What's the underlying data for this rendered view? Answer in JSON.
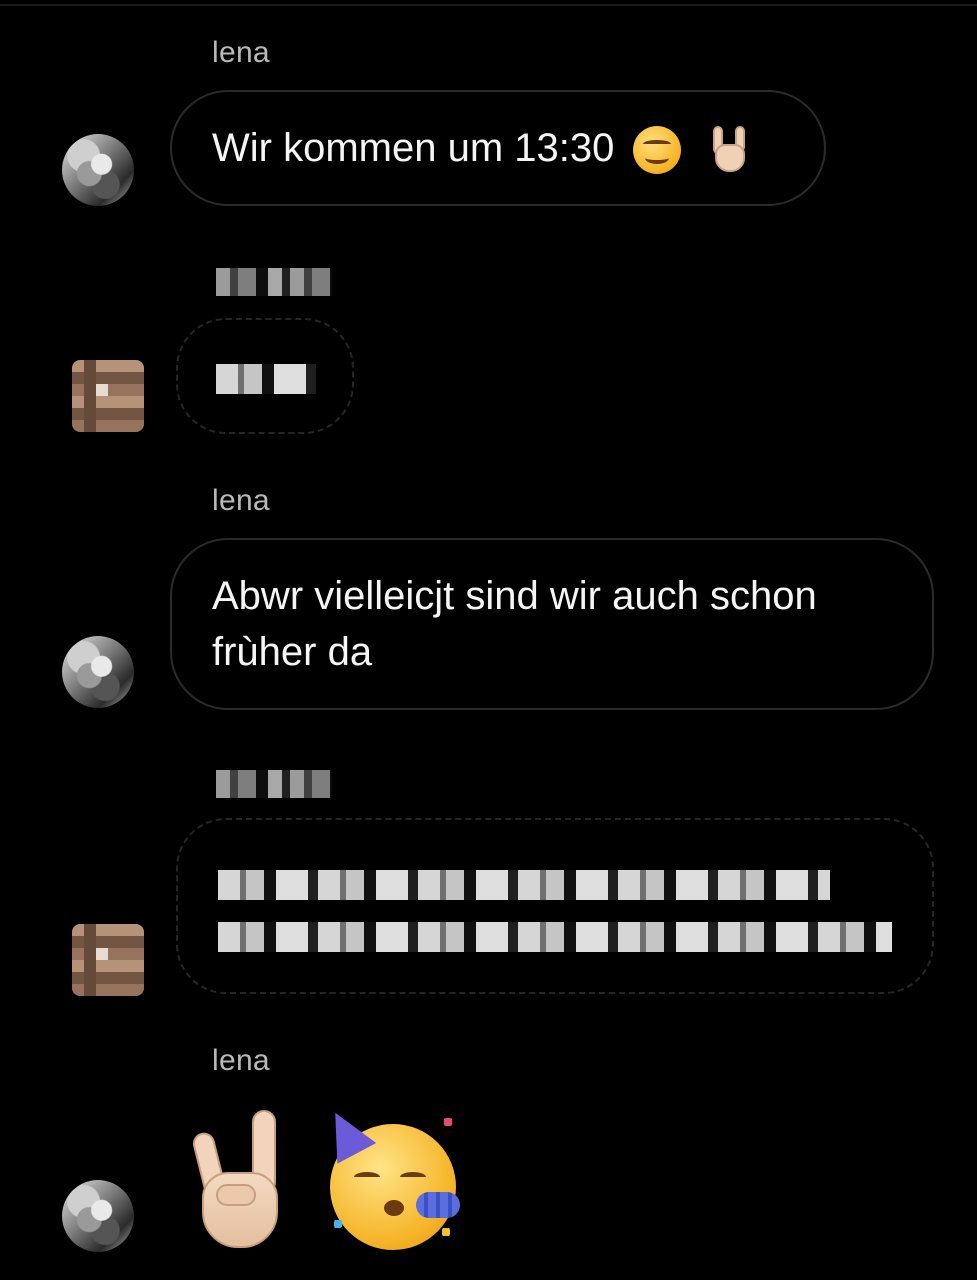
{
  "chat": {
    "messages": [
      {
        "sender": "lena",
        "text": "Wir kommen um 13:30",
        "emojis": [
          "smiling-face-icon",
          "sign-of-the-horns-icon"
        ]
      },
      {
        "sender": "",
        "text": "",
        "redacted": true
      },
      {
        "sender": "lena",
        "text": "Abwr vielleicjt sind wir auch schon frùher da"
      },
      {
        "sender": "",
        "text": "",
        "redacted": true
      },
      {
        "sender": "lena",
        "text": "",
        "emojis": [
          "sign-of-the-horns-icon",
          "partying-face-icon"
        ]
      }
    ]
  },
  "colors": {
    "background": "#000000",
    "bubble_border": "#2b2b2b",
    "sender_text": "#b9b9b9",
    "message_text": "#f5f5f5"
  }
}
